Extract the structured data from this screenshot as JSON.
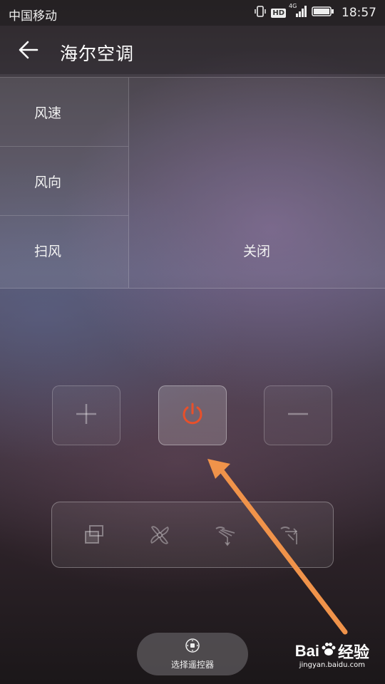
{
  "status_bar": {
    "carrier": "中国移动",
    "hd_label": "HD",
    "network_label": "4G",
    "time": "18:57"
  },
  "app_bar": {
    "title": "海尔空调",
    "back_icon": "back-arrow-icon"
  },
  "settings_panel": {
    "items": [
      {
        "label": "风速"
      },
      {
        "label": "风向"
      },
      {
        "label": "扫风"
      }
    ],
    "value": "关闭"
  },
  "controls": {
    "plus_icon": "plus-icon",
    "power_icon": "power-icon",
    "minus_icon": "minus-icon",
    "power_color": "#e8502a"
  },
  "mode_bar": {
    "icons": [
      "mode-icon",
      "fan-icon",
      "swing-vertical-icon",
      "swing-horizontal-icon"
    ]
  },
  "select_remote": {
    "label": "选择遥控器",
    "icon": "remote-dpad-icon"
  },
  "annotation": {
    "arrow_color": "#f0934a"
  },
  "watermark": {
    "brand_left": "Bai",
    "brand_right": "经验",
    "url": "jingyan.baidu.com"
  }
}
